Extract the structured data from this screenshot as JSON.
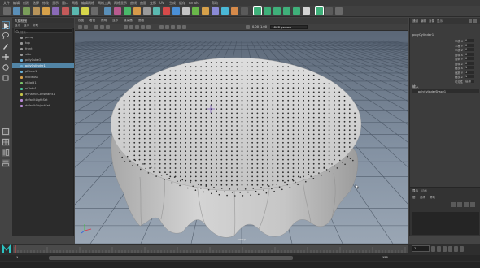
{
  "app": {
    "name": "Maya",
    "logo_letter": "M",
    "accent_color": "#2bc3c2",
    "selection_color": "#5285a6"
  },
  "menubar": {
    "items": [
      "文件",
      "编辑",
      "创建",
      "选择",
      "修改",
      "显示",
      "窗口",
      "网格",
      "编辑网格",
      "网格工具",
      "网格显示",
      "曲线",
      "曲面",
      "变形",
      "UV",
      "生成",
      "缓存",
      "Arnold",
      "帮助"
    ]
  },
  "outliner": {
    "title": "大纲视图",
    "menu": [
      "显示",
      "显示",
      "帮助"
    ],
    "search_placeholder": "搜索...",
    "items": [
      {
        "label": "persp",
        "icon": "camera-icon",
        "selected": false
      },
      {
        "label": "top",
        "icon": "camera-icon",
        "selected": false
      },
      {
        "label": "front",
        "icon": "camera-icon",
        "selected": false
      },
      {
        "label": "side",
        "icon": "camera-icon",
        "selected": false
      },
      {
        "label": "polyCube1",
        "icon": "mesh-icon",
        "selected": false
      },
      {
        "label": "polyCylinder1",
        "icon": "mesh-icon",
        "selected": true
      },
      {
        "label": "pPlane1",
        "icon": "mesh-icon",
        "selected": false
      },
      {
        "label": "nucleus1",
        "icon": "nucleus-icon",
        "selected": false
      },
      {
        "label": "nRigid1",
        "icon": "rigid-icon",
        "selected": false
      },
      {
        "label": "nCloth1",
        "icon": "cloth-icon",
        "selected": false
      },
      {
        "label": "dynamicConstraint1",
        "icon": "constraint-icon",
        "selected": false
      },
      {
        "label": "defaultLightSet",
        "icon": "set-icon",
        "selected": false
      },
      {
        "label": "defaultObjectSet",
        "icon": "set-icon",
        "selected": false
      }
    ]
  },
  "viewport": {
    "menu": [
      "视图",
      "着色",
      "照明",
      "显示",
      "渲染器",
      "面板"
    ],
    "field_value": "sRGB gamma",
    "numeric_values": [
      "0.00",
      "1.00"
    ],
    "camera_label": "persp"
  },
  "channel_box": {
    "menu": [
      "通道",
      "编辑",
      "对象",
      "显示"
    ],
    "object_name": "polyCylinder1",
    "attributes": [
      {
        "name": "平移 X",
        "value": "0"
      },
      {
        "name": "平移 Y",
        "value": "0"
      },
      {
        "name": "平移 Z",
        "value": "0"
      },
      {
        "name": "旋转 X",
        "value": "0"
      },
      {
        "name": "旋转 Y",
        "value": "0"
      },
      {
        "name": "旋转 Z",
        "value": "0"
      },
      {
        "name": "缩放 X",
        "value": "1"
      },
      {
        "name": "缩放 Y",
        "value": "1"
      },
      {
        "name": "缩放 Z",
        "value": "1"
      },
      {
        "name": "可见性",
        "value": "启用"
      }
    ],
    "shapes_label": "形状",
    "inputs_label": "输入",
    "input_item": "polyCylinderShape1",
    "layer_tabs": [
      "显示",
      "动画"
    ],
    "layer_menu": [
      "层",
      "选项",
      "帮助"
    ]
  },
  "timeline": {
    "current_frame": "1",
    "range_start": "1",
    "range_end": "120"
  }
}
